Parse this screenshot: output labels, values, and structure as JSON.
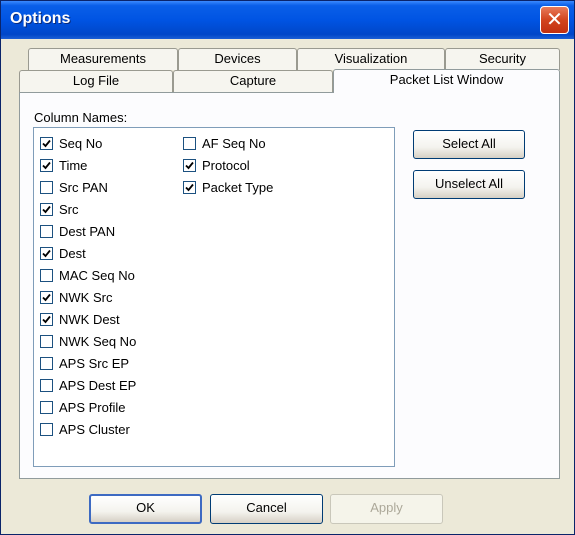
{
  "window": {
    "title": "Options",
    "close_glyph": "✕"
  },
  "tabs_row_back": [
    {
      "label": "Measurements"
    },
    {
      "label": "Devices"
    },
    {
      "label": "Visualization"
    },
    {
      "label": "Security"
    }
  ],
  "tabs_row_front": [
    {
      "label": "Log File"
    },
    {
      "label": "Capture"
    },
    {
      "label": "Packet List Window",
      "active": true
    }
  ],
  "packet_list": {
    "column_names_label": "Column Names:",
    "columns": [
      {
        "label": "Seq No",
        "checked": true
      },
      {
        "label": "Time",
        "checked": true
      },
      {
        "label": "Src PAN",
        "checked": false
      },
      {
        "label": "Src",
        "checked": true
      },
      {
        "label": "Dest PAN",
        "checked": false
      },
      {
        "label": "Dest",
        "checked": true
      },
      {
        "label": "MAC Seq No",
        "checked": false
      },
      {
        "label": "NWK Src",
        "checked": true
      },
      {
        "label": "NWK Dest",
        "checked": true
      },
      {
        "label": "NWK Seq No",
        "checked": false
      },
      {
        "label": "APS Src EP",
        "checked": false
      },
      {
        "label": "APS Dest EP",
        "checked": false
      },
      {
        "label": "APS Profile",
        "checked": false
      },
      {
        "label": "APS Cluster",
        "checked": false
      },
      {
        "label": "AF Seq No",
        "checked": false
      },
      {
        "label": "Protocol",
        "checked": true
      },
      {
        "label": "Packet Type",
        "checked": true
      }
    ],
    "select_all_label": "Select All",
    "unselect_all_label": "Unselect All"
  },
  "footer": {
    "ok_label": "OK",
    "cancel_label": "Cancel",
    "apply_label": "Apply"
  }
}
